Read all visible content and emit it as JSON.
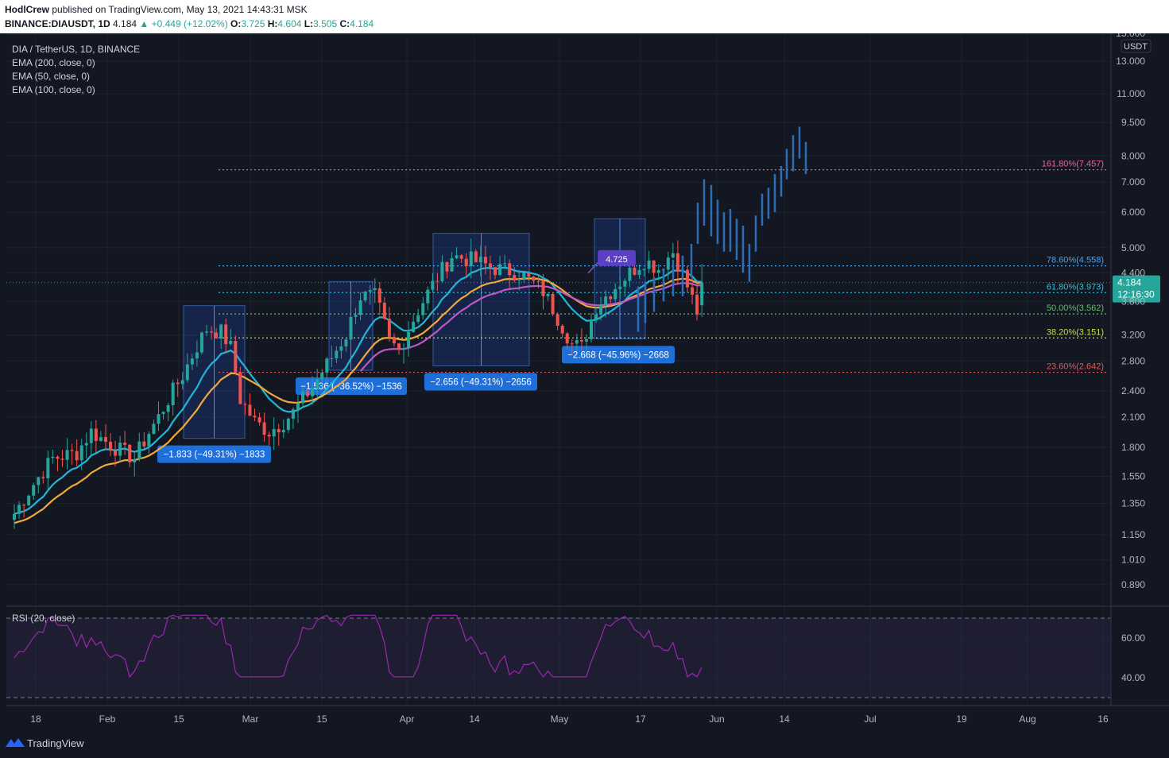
{
  "header": {
    "publisher": "HodlCrew",
    "published_text": "published on TradingView.com, May 13, 2021 14:43:31 MSK",
    "symbol_line": "BINANCE:DIAUSDT, 1D",
    "last": "4.184",
    "change": "▲ +0.449 (+12.02%)",
    "o_label": "O:",
    "o_value": "3.725",
    "h_label": "H:",
    "h_value": "4.604",
    "l_label": "L:",
    "l_value": "3.505",
    "c_label": "C:",
    "c_value": "4.184"
  },
  "legend": {
    "title": "DIA / TetherUS, 1D, BINANCE",
    "ema200": "EMA (200, close, 0)",
    "ema50": "EMA (50, close, 0)",
    "ema100": "EMA (100, close, 0)"
  },
  "rsi_label": "RSI (20, close)",
  "price_axis_unit": "USDT",
  "price_badge": {
    "value": "4.184",
    "countdown": "12:16:30"
  },
  "footer_brand": "TradingView",
  "colors": {
    "up": "#26a69a",
    "down": "#ef5350",
    "ema_cyan": "#22b5d8",
    "ema_orange": "#f2a93b",
    "ema_magenta": "#c057c7",
    "rsi": "#9c27b0",
    "measure_box": "#2962ff",
    "projection": "#2f6db6"
  },
  "chart_data": {
    "type": "candlestick",
    "title": "DIA / TetherUS, 1D, BINANCE",
    "y_scale": "log",
    "ylim": [
      0.8,
      15.0
    ],
    "y_ticks": [
      "0.890",
      "1.010",
      "1.150",
      "1.350",
      "1.550",
      "1.800",
      "2.100",
      "2.400",
      "2.800",
      "3.200",
      "3.800",
      "4.400",
      "5.000",
      "6.000",
      "7.000",
      "8.000",
      "9.500",
      "11.000",
      "13.000",
      "15.000"
    ],
    "x_ticks": [
      "18",
      "Feb",
      "15",
      "Mar",
      "15",
      "Apr",
      "14",
      "May",
      "17",
      "Jun",
      "14",
      "Jul",
      "19",
      "Aug",
      "16"
    ],
    "last_price": 4.184,
    "ohlc_last": {
      "open": 3.725,
      "high": 4.604,
      "low": 3.505,
      "close": 4.184
    },
    "fib_levels": [
      {
        "label": "161.80%(7.457)",
        "value": 7.457,
        "color": "#f06292"
      },
      {
        "label": "78.60%(4.558)",
        "value": 4.558,
        "color": "#42a5f5"
      },
      {
        "label": "61.80%(3.973)",
        "value": 3.973,
        "color": "#26c6da"
      },
      {
        "label": "50.00%(3.562)",
        "value": 3.562,
        "color": "#66bb6a"
      },
      {
        "label": "38.20%(3.151)",
        "value": 3.151,
        "color": "#cddc39"
      },
      {
        "label": "23.60%(2.642)",
        "value": 2.642,
        "color": "#ef5350"
      }
    ],
    "measurements": [
      {
        "label": "−1.833 (−49.31%) −1833",
        "top": 3.717,
        "bottom": 1.884
      },
      {
        "label": "−1.536 (−36.52%) −1536",
        "top": 4.206,
        "bottom": 2.67
      },
      {
        "label": "−2.656 (−49.31%) −2656",
        "top": 5.386,
        "bottom": 2.73
      },
      {
        "label": "−2.668 (−45.96%) −2668",
        "top": 5.805,
        "bottom": 3.137
      }
    ],
    "annotation": {
      "label": "4.725",
      "value": 4.725
    },
    "rsi": {
      "label": "RSI (20, close)",
      "y_ticks": [
        "40.00",
        "60.00"
      ],
      "upper": 70,
      "lower": 30
    },
    "series": [
      {
        "name": "EMA (200, close, 0)"
      },
      {
        "name": "EMA (50, close, 0)"
      },
      {
        "name": "EMA (100, close, 0)"
      }
    ]
  }
}
